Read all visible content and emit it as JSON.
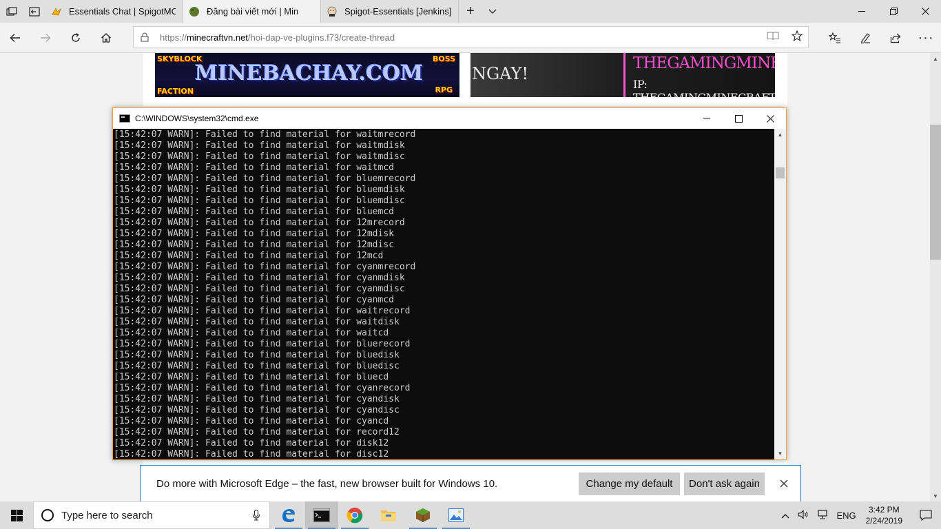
{
  "browser": {
    "tabs": [
      {
        "title": "Essentials Chat | SpigotMC -",
        "active": false
      },
      {
        "title": "Đăng bài viết mới | Min",
        "active": true
      },
      {
        "title": "Spigot-Essentials [Jenkins]",
        "active": false
      }
    ],
    "address": {
      "scheme": "https://",
      "host": "minecraftvn.net",
      "path": "/hoi-dap-ve-plugins.f73/create-thread"
    }
  },
  "page": {
    "banner_left": {
      "main": "MINEBACHAY.COM",
      "top_left": "SKYBLOCK",
      "top_right": "BOSS",
      "bottom_left": "FACTION",
      "bottom_right": "RPG"
    },
    "banner_right": {
      "left_text": "NGAY!",
      "title": "THEGAMINGMINECRAFT",
      "subtitle": "IP: THEGAMINGMINECRAFT.COM"
    }
  },
  "cmd": {
    "title": "C:\\WINDOWS\\system32\\cmd.exe",
    "lines": [
      "[15:42:07 WARN]: Failed to find material for waitmrecord",
      "[15:42:07 WARN]: Failed to find material for waitmdisk",
      "[15:42:07 WARN]: Failed to find material for waitmdisc",
      "[15:42:07 WARN]: Failed to find material for waitmcd",
      "[15:42:07 WARN]: Failed to find material for bluemrecord",
      "[15:42:07 WARN]: Failed to find material for bluemdisk",
      "[15:42:07 WARN]: Failed to find material for bluemdisc",
      "[15:42:07 WARN]: Failed to find material for bluemcd",
      "[15:42:07 WARN]: Failed to find material for 12mrecord",
      "[15:42:07 WARN]: Failed to find material for 12mdisk",
      "[15:42:07 WARN]: Failed to find material for 12mdisc",
      "[15:42:07 WARN]: Failed to find material for 12mcd",
      "[15:42:07 WARN]: Failed to find material for cyanmrecord",
      "[15:42:07 WARN]: Failed to find material for cyanmdisk",
      "[15:42:07 WARN]: Failed to find material for cyanmdisc",
      "[15:42:07 WARN]: Failed to find material for cyanmcd",
      "[15:42:07 WARN]: Failed to find material for waitrecord",
      "[15:42:07 WARN]: Failed to find material for waitdisk",
      "[15:42:07 WARN]: Failed to find material for waitcd",
      "[15:42:07 WARN]: Failed to find material for bluerecord",
      "[15:42:07 WARN]: Failed to find material for bluedisk",
      "[15:42:07 WARN]: Failed to find material for bluedisc",
      "[15:42:07 WARN]: Failed to find material for bluecd",
      "[15:42:07 WARN]: Failed to find material for cyanrecord",
      "[15:42:07 WARN]: Failed to find material for cyandisk",
      "[15:42:07 WARN]: Failed to find material for cyandisc",
      "[15:42:07 WARN]: Failed to find material for cyancd",
      "[15:42:07 WARN]: Failed to find material for record12",
      "[15:42:07 WARN]: Failed to find material for disk12",
      "[15:42:07 WARN]: Failed to find material for disc12"
    ]
  },
  "notification": {
    "text": "Do more with Microsoft Edge – the fast, new browser built for Windows 10.",
    "change_default": "Change my default",
    "dont_ask": "Don't ask again"
  },
  "taskbar": {
    "search_placeholder": "Type here to search",
    "language": "ENG",
    "time": "3:42 PM",
    "date": "2/24/2019"
  },
  "colors": {
    "accent": "#1f79d3",
    "cmd_border": "#f0a330",
    "cmd_bg": "#0c0c0c",
    "cmd_text": "#cccccc"
  }
}
